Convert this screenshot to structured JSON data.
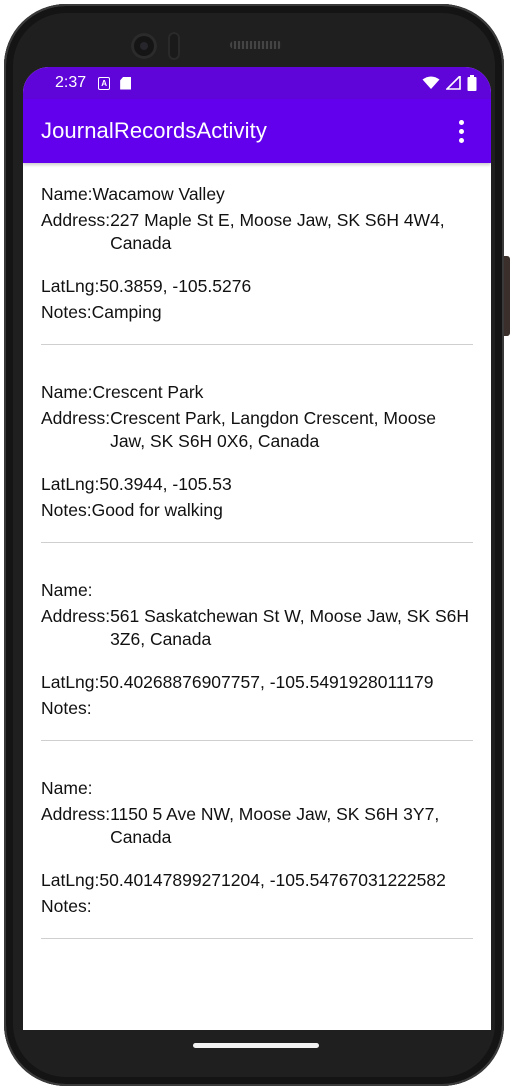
{
  "status_bar": {
    "time": "2:37",
    "icons": [
      "a-notification-icon",
      "sd-card-icon",
      "wifi-icon",
      "signal-icon",
      "battery-icon"
    ]
  },
  "app_bar": {
    "title": "JournalRecordsActivity",
    "menu_icon": "more-vert-icon"
  },
  "records": [
    {
      "name_label": "Name:",
      "name": "Wacamow Valley",
      "address_label": "Address:",
      "address": "227 Maple St E, Moose Jaw, SK S6H 4W4, Canada",
      "latlng_label": "LatLng:",
      "latlng": "50.3859, -105.5276",
      "notes_label": "Notes:",
      "notes": "Camping"
    },
    {
      "name_label": "Name:",
      "name": "Crescent Park",
      "address_label": "Address:",
      "address": "Crescent Park, Langdon Crescent, Moose Jaw, SK S6H 0X6, Canada",
      "latlng_label": "LatLng:",
      "latlng": "50.3944, -105.53",
      "notes_label": "Notes:",
      "notes": "Good for walking"
    },
    {
      "name_label": "Name:",
      "name": "",
      "address_label": "Address:",
      "address": "561 Saskatchewan St W, Moose Jaw, SK S6H 3Z6, Canada",
      "latlng_label": "LatLng:",
      "latlng": "50.40268876907757, -105.5491928011179",
      "notes_label": "Notes:",
      "notes": ""
    },
    {
      "name_label": "Name:",
      "name": "",
      "address_label": "Address:",
      "address": "1150 5 Ave NW, Moose Jaw, SK S6H 3Y7, Canada",
      "latlng_label": "LatLng:",
      "latlng": "50.40147899271204, -105.54767031222582",
      "notes_label": "Notes:",
      "notes": ""
    }
  ],
  "colors": {
    "status_bar": "#5f05d9",
    "app_bar": "#6200ee",
    "divider": "#cfcfcf"
  }
}
